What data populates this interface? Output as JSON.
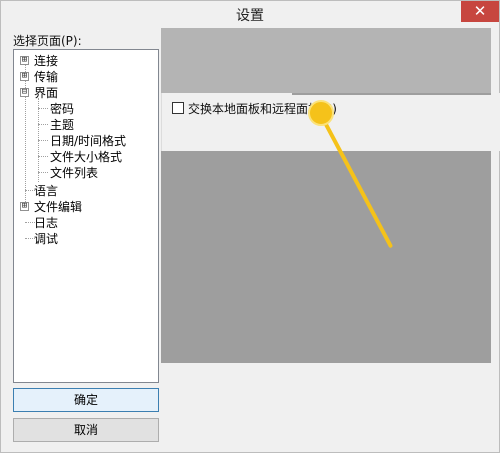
{
  "window": {
    "title": "设置",
    "close_symbol": "✕"
  },
  "sidebar": {
    "label": "选择页面(P):",
    "tree": [
      {
        "label": "连接",
        "expandable": true,
        "expanded": false
      },
      {
        "label": "传输",
        "expandable": true,
        "expanded": false
      },
      {
        "label": "界面",
        "expandable": true,
        "expanded": true
      },
      {
        "label": "密码",
        "expandable": false
      },
      {
        "label": "主题",
        "expandable": false
      },
      {
        "label": "日期/时间格式",
        "expandable": false
      },
      {
        "label": "文件大小格式",
        "expandable": false
      },
      {
        "label": "文件列表",
        "expandable": false
      },
      {
        "label": "语言",
        "expandable": false
      },
      {
        "label": "文件编辑",
        "expandable": true,
        "expanded": false
      },
      {
        "label": "日志",
        "expandable": false
      },
      {
        "label": "调试",
        "expandable": false
      }
    ]
  },
  "buttons": {
    "ok": "确定",
    "cancel": "取消"
  },
  "panel": {
    "swap_checkbox_label": "交换本地面板和远程面板(S)",
    "swap_checked": false
  },
  "icons": {
    "expand_collapsed": "⊞",
    "expand_open": "⊟"
  },
  "colors": {
    "close_button": "#c7463f",
    "cursor_highlight": "#f5c21a"
  }
}
